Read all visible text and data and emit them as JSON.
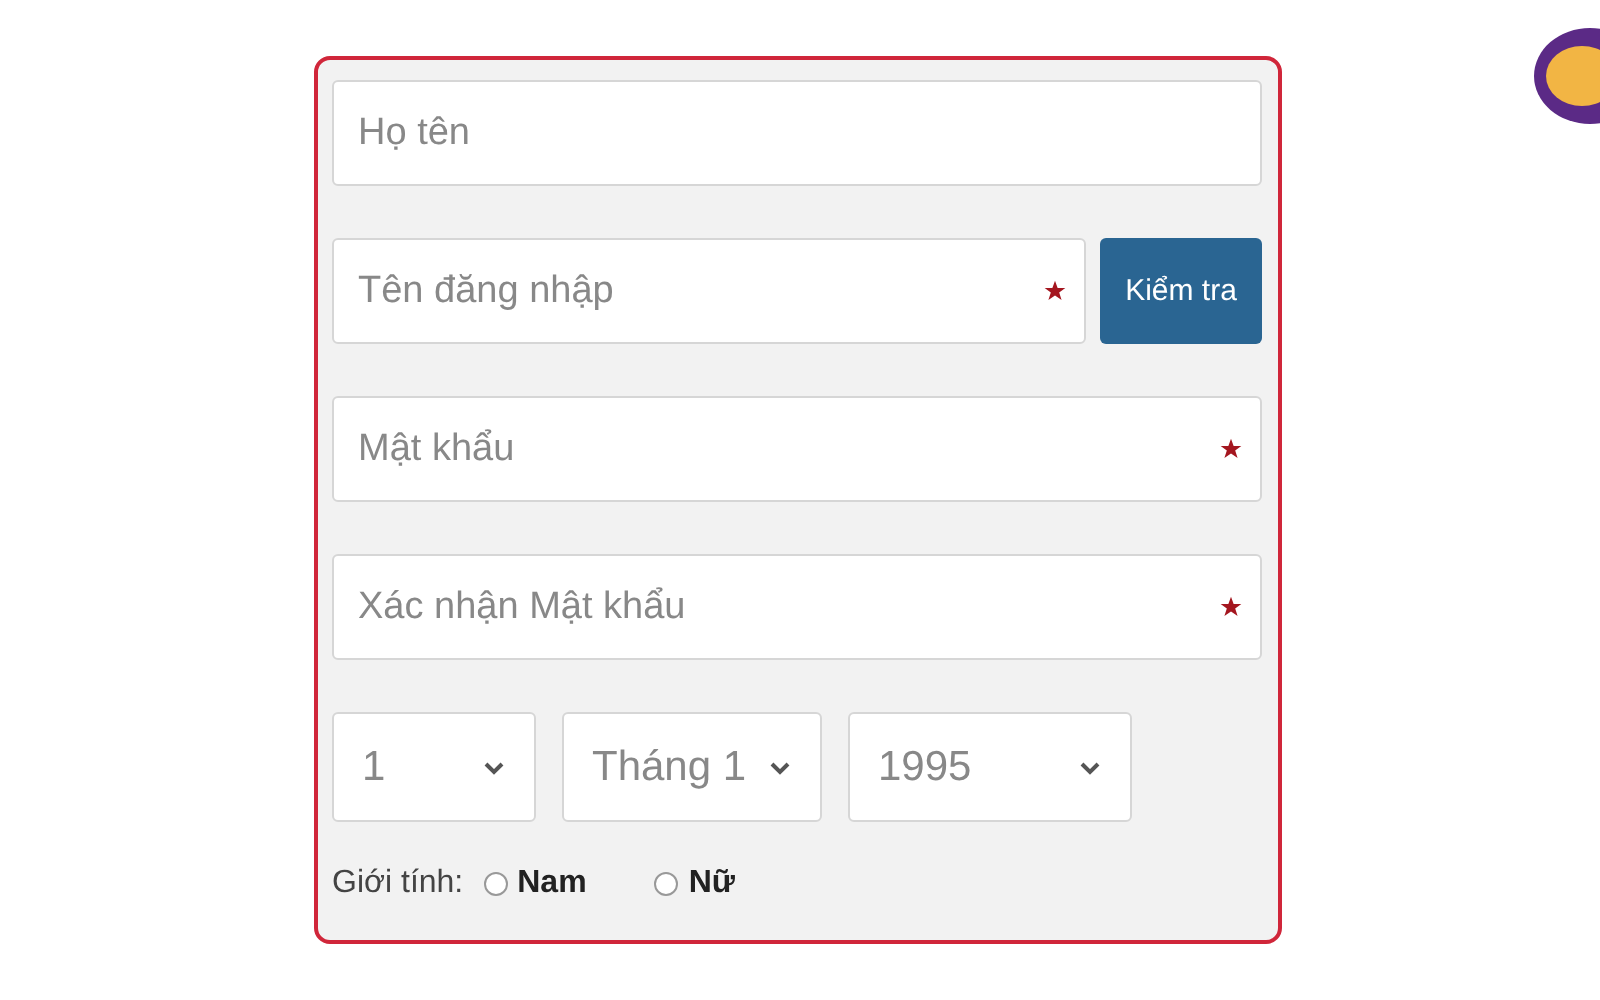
{
  "fields": [
    {
      "placeholder": "Họ tên",
      "required": false
    },
    {
      "placeholder": "Tên đăng nhập",
      "required": true,
      "button": "Kiểm tra"
    },
    {
      "placeholder": "Mật khẩu",
      "required": true
    },
    {
      "placeholder": "Xác nhận Mật khẩu",
      "required": true
    }
  ],
  "birth_date": [
    {
      "value": "1"
    },
    {
      "value": "Tháng 1"
    },
    {
      "value": "1995"
    }
  ],
  "gender": {
    "label": "Giới tính:",
    "options": [
      {
        "label": "Nam",
        "selected": false
      },
      {
        "label": "Nữ",
        "selected": false
      }
    ]
  }
}
